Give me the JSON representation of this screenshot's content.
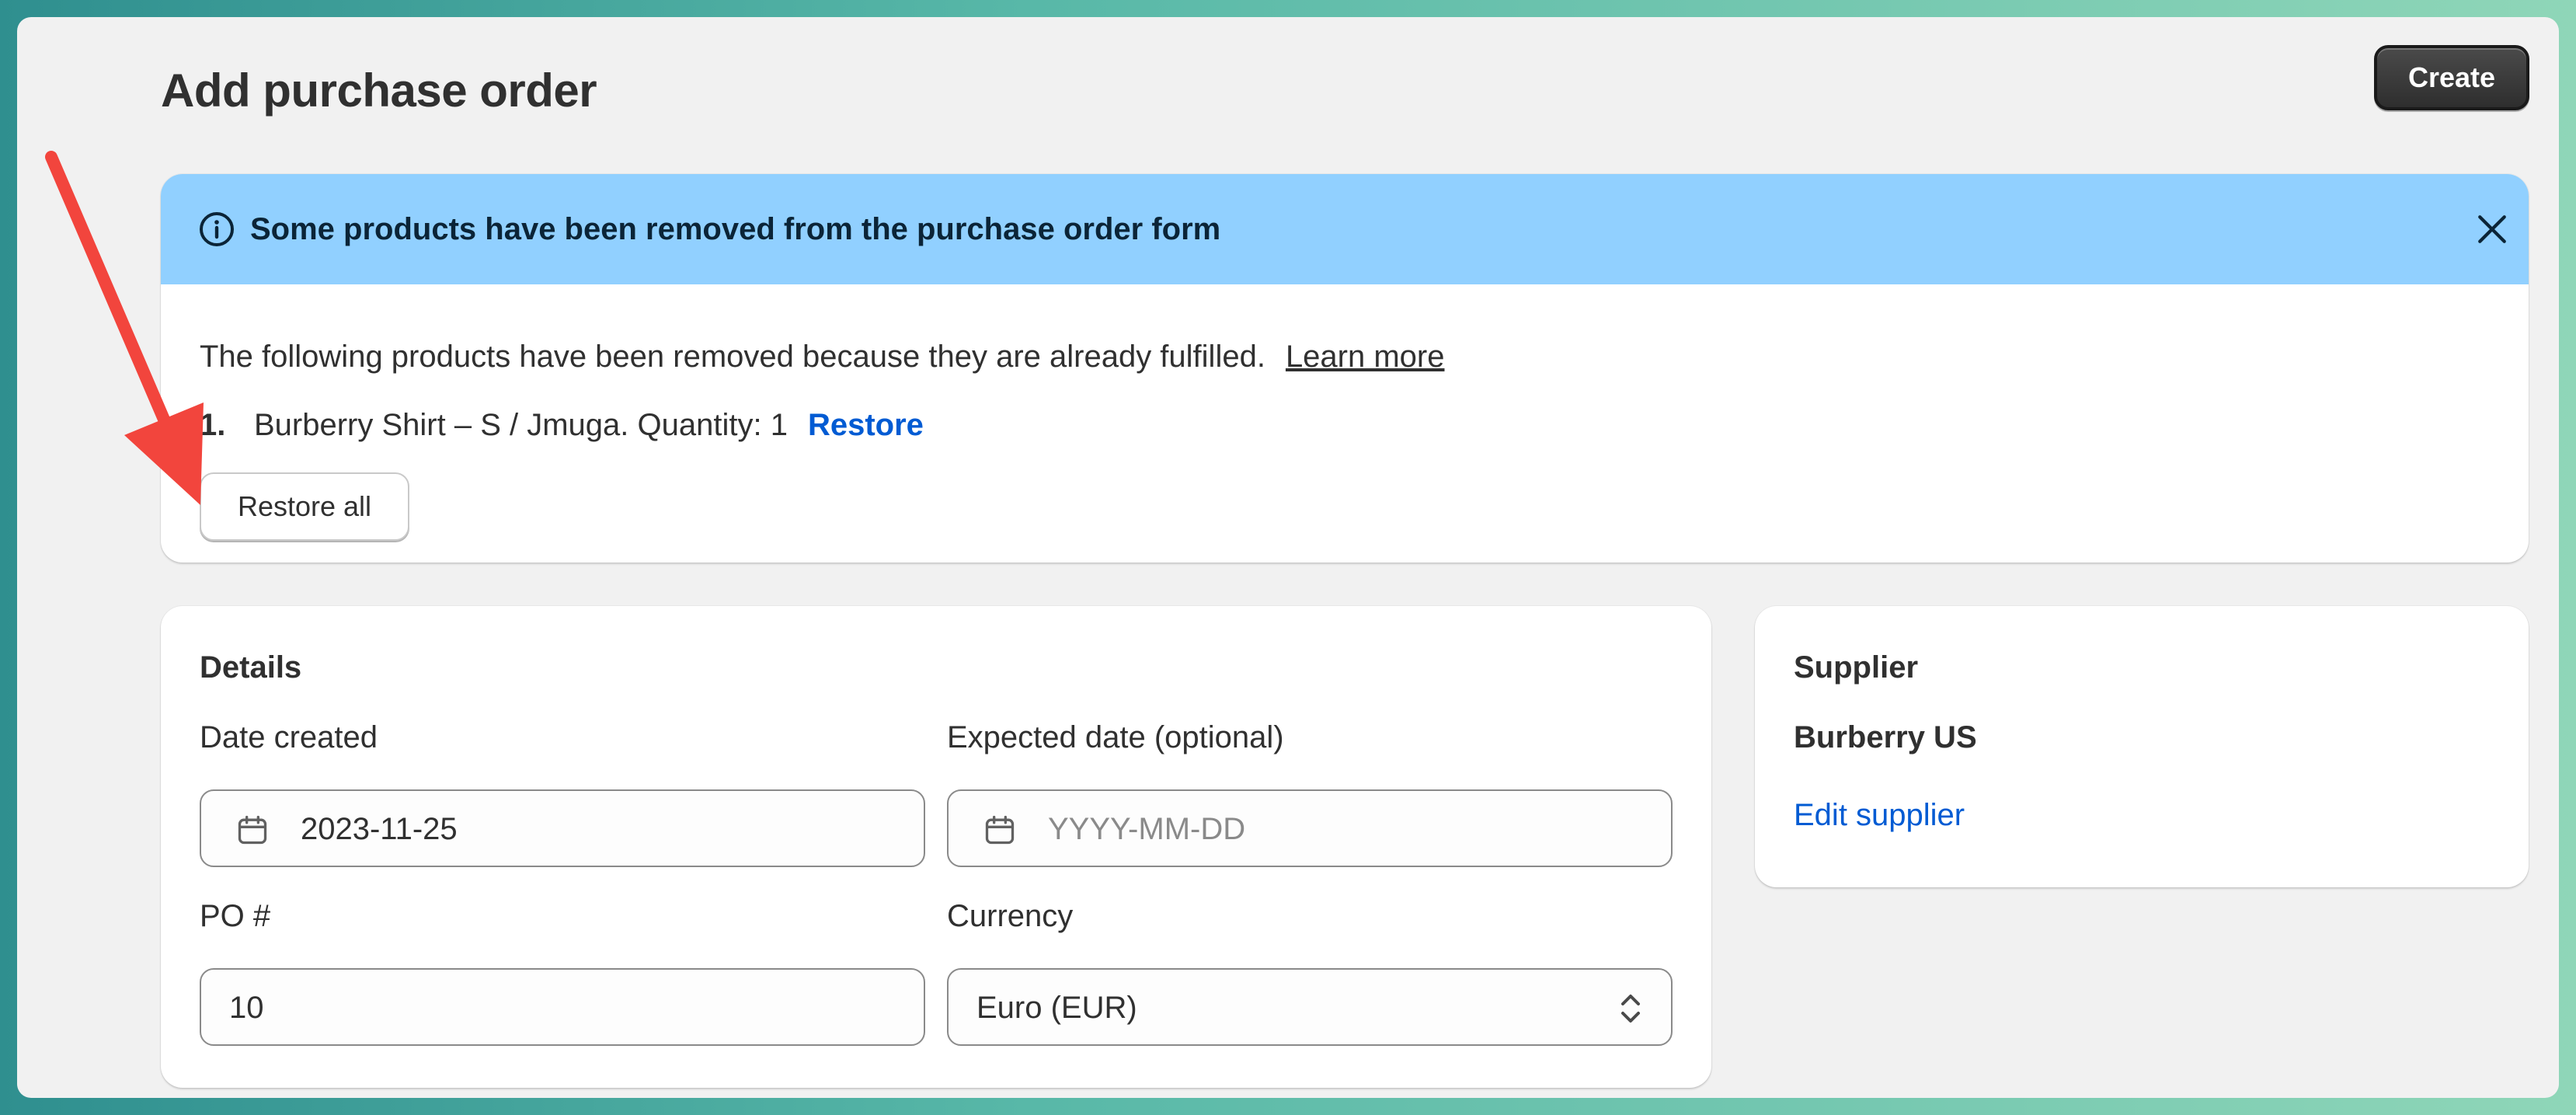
{
  "header": {
    "title": "Add purchase order",
    "create_label": "Create"
  },
  "banner": {
    "title": "Some products have been removed from the purchase order form",
    "body": "The following products have been removed because they are already fulfilled.",
    "learn_more": "Learn more",
    "items": [
      {
        "number": "1.",
        "text": "Burberry Shirt – S / Jmuga. Quantity: 1",
        "restore_label": "Restore"
      }
    ],
    "restore_all_label": "Restore all"
  },
  "details": {
    "heading": "Details",
    "date_created_label": "Date created",
    "date_created_value": "2023-11-25",
    "expected_date_label": "Expected date (optional)",
    "expected_date_placeholder": "YYYY-MM-DD",
    "po_label": "PO #",
    "po_value": "10",
    "currency_label": "Currency",
    "currency_value": "Euro (EUR)"
  },
  "supplier": {
    "heading": "Supplier",
    "name": "Burberry US",
    "edit_label": "Edit supplier"
  },
  "colors": {
    "banner_head": "#91d0ff",
    "link": "#005bd3",
    "annotation_arrow": "#f2453d"
  },
  "icons": {
    "banner": "info-icon",
    "dismiss": "close-icon",
    "date": "calendar-icon",
    "select": "select-arrows-icon"
  }
}
